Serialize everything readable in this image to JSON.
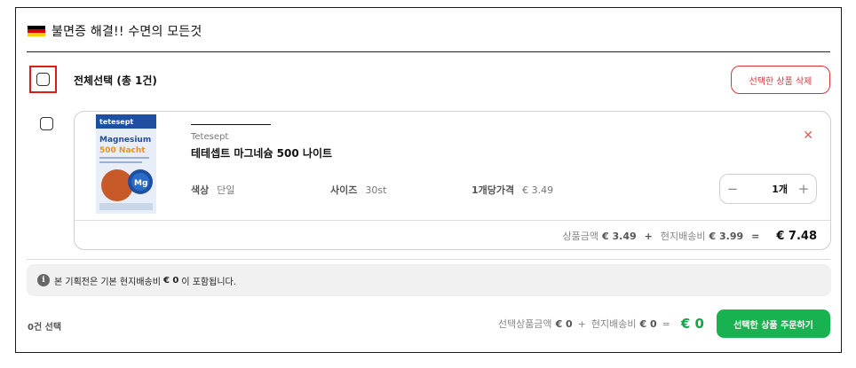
{
  "header": {
    "title": "불면증 해결!! 수면의 모든것",
    "flag_colors": [
      "#000000",
      "#dd0000",
      "#ffce00"
    ]
  },
  "select_all": {
    "label": "전체선택 (총 1건)",
    "checked": false
  },
  "delete_selected_label": "선택한 상품 삭제",
  "item": {
    "checked": false,
    "brand": "Tetesept",
    "name": "테테셉트 마그네슘 500 나이트",
    "image_text": {
      "brand": "tetesept",
      "line1": "Magnesium",
      "line2": "500 Nacht",
      "badge": "Mg"
    },
    "options": [
      {
        "label": "색상",
        "value": "단일"
      },
      {
        "label": "사이즈",
        "value": "30st"
      },
      {
        "label": "1개당가격",
        "value": "€ 3.49"
      }
    ],
    "quantity": "1개",
    "summary": {
      "product_label": "상품금액",
      "product_value": "€ 3.49",
      "plus": "+",
      "shipping_label": "현지배송비",
      "shipping_value": "€ 3.99",
      "equals": "=",
      "total": "€ 7.48"
    }
  },
  "notice": {
    "before": "본 기획전은 기본 현지배송비",
    "value": "€ 0",
    "after": "이 포함됩니다."
  },
  "footer": {
    "count": "0건 선택",
    "selected_label": "선택상품금액",
    "selected_value": "€ 0",
    "plus": "+",
    "shipping_label": "현지배송비",
    "shipping_value": "€ 0",
    "equals": "=",
    "total": "€ 0",
    "order_label": "선택한 상품 주문하기"
  },
  "colors": {
    "accent_red": "#d9333d",
    "highlight_red": "#e01919",
    "green": "#19b250"
  }
}
